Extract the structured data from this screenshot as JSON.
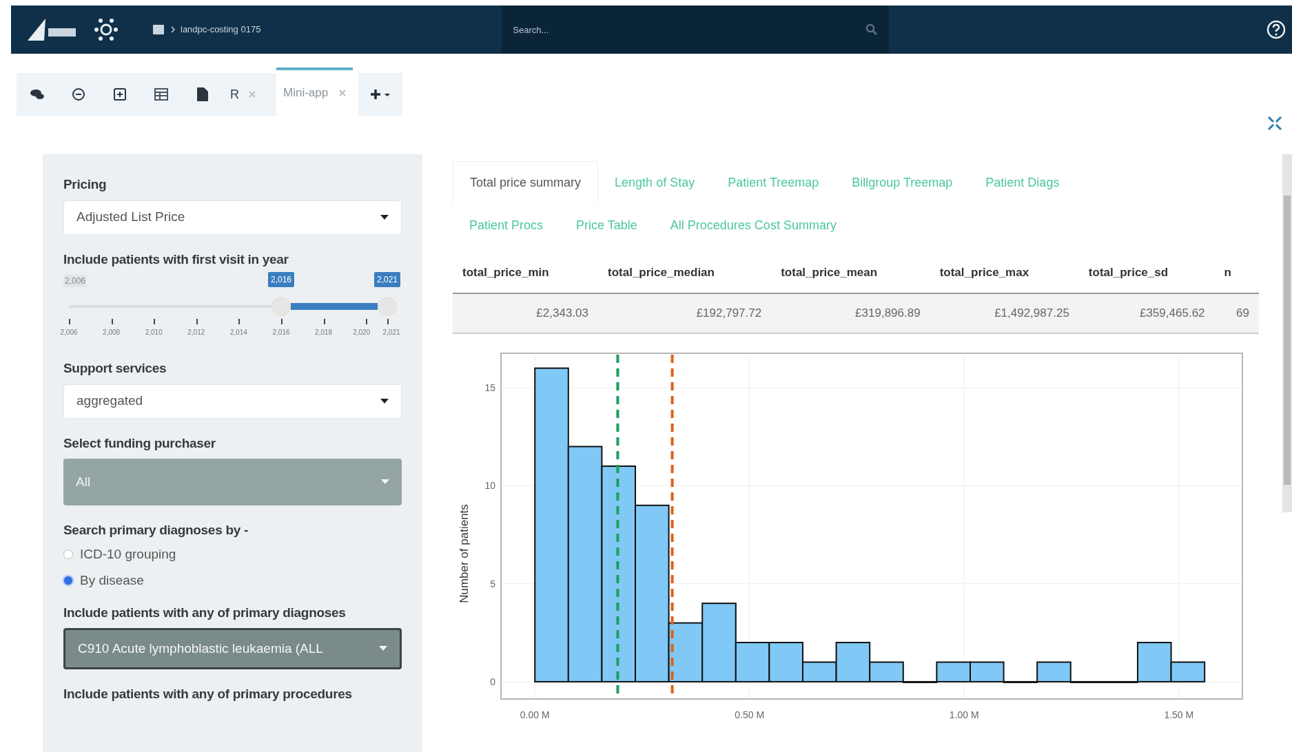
{
  "app_bar": {
    "breadcrumb": "landpc-costing 0175",
    "search": {
      "placeholder": "Search..."
    }
  },
  "workspace_tabs": [
    {
      "label": "R",
      "selected": false
    },
    {
      "label": "Mini-app",
      "selected": true
    }
  ],
  "sidebar": {
    "controls": [
      {
        "kind": "select",
        "label": "Pricing",
        "value": "Adjusted List Price"
      },
      {
        "kind": "range",
        "label": "Include patients with first visit in year",
        "min_label": "2,006",
        "thumbs": [
          {
            "label": "2,016"
          },
          {
            "label": "2,021"
          }
        ],
        "ticks": [
          "2,006",
          "2,008",
          "2,010",
          "2,012",
          "2,014",
          "2,016",
          "2,018",
          "2,020",
          "2,021"
        ]
      },
      {
        "kind": "select",
        "label": "Support services",
        "value": "aggregated"
      },
      {
        "kind": "picker",
        "label": "Select funding purchaser",
        "value": "All",
        "focused": false
      },
      {
        "kind": "radio",
        "label": "Search primary diagnoses by -",
        "options": [
          {
            "label": "ICD-10 grouping",
            "selected": false
          },
          {
            "label": "By disease",
            "selected": true
          }
        ]
      },
      {
        "kind": "picker",
        "label": "Include patients with any of primary diagnoses",
        "value": "C910 Acute lymphoblastic leukaemia (ALL",
        "focused": true
      },
      {
        "kind": "heading",
        "label": "Include patients with any of primary procedures"
      }
    ]
  },
  "content_tabs": [
    {
      "label": "Total price summary",
      "selected": true
    },
    {
      "label": "Length of Stay",
      "selected": false
    },
    {
      "label": "Patient Treemap",
      "selected": false
    },
    {
      "label": "Billgroup Treemap",
      "selected": false
    },
    {
      "label": "Patient Diags",
      "selected": false
    },
    {
      "label": "Patient Procs",
      "selected": false
    },
    {
      "label": "Price Table",
      "selected": false
    },
    {
      "label": "All Procedures Cost Summary",
      "selected": false
    }
  ],
  "summary_table": {
    "columns": [
      "total_price_min",
      "total_price_median",
      "total_price_mean",
      "total_price_max",
      "total_price_sd",
      "n"
    ],
    "rows": [
      [
        "£2,343.03",
        "£192,797.72",
        "£319,896.89",
        "£1,492,987.25",
        "£359,465.62",
        "69"
      ]
    ]
  },
  "chart": {
    "chart_data": {
      "type": "bar",
      "ylabel": "Number of patients",
      "x": [
        0.039,
        0.117,
        0.195,
        0.273,
        0.351,
        0.429,
        0.507,
        0.585,
        0.663,
        0.741,
        0.819,
        0.897,
        0.975,
        1.053,
        1.131,
        1.209,
        1.287,
        1.365,
        1.443,
        1.521
      ],
      "values": [
        16,
        12,
        11,
        9,
        3,
        4,
        2,
        2,
        1,
        2,
        1,
        0,
        1,
        1,
        0,
        1,
        0,
        0,
        2,
        1
      ],
      "xlim": [
        -0.079,
        1.648
      ],
      "ylim": [
        -0.88,
        16.76
      ],
      "xticks": [
        {
          "value": 0,
          "label": "0.00 M"
        },
        {
          "value": 0.5,
          "label": "0.50 M"
        },
        {
          "value": 1,
          "label": "1.00 M"
        },
        {
          "value": 1.5,
          "label": "1.50 M"
        }
      ],
      "yticks": [
        0,
        5,
        10,
        15
      ],
      "grid": true,
      "ref_lines": [
        {
          "axis": "x",
          "value": 0.193,
          "color": "#1aa05a"
        },
        {
          "axis": "x",
          "value": 0.32,
          "color": "#e0601a"
        }
      ]
    }
  }
}
